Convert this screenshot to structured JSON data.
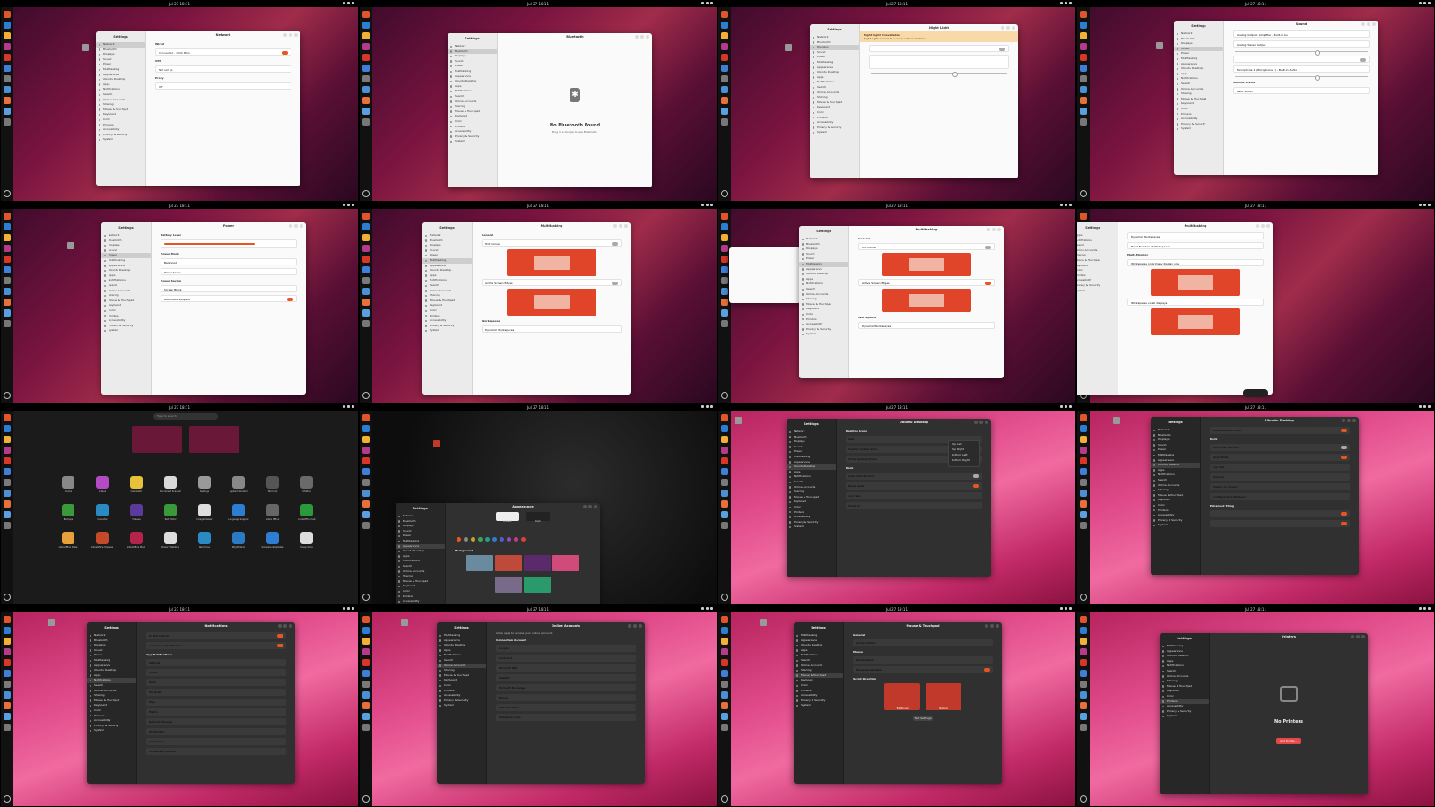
{
  "clock": "Jul 27  18:11",
  "dock_colors": [
    "#e2552b",
    "#2d7dd2",
    "#f2b134",
    "#b63a8a",
    "#d9362a",
    "#3e7fd9",
    "#7a7a7a",
    "#4b8fd4",
    "#e8703a",
    "#5aa0e0",
    "#777777"
  ],
  "settings_sidebar": [
    "Network",
    "Bluetooth",
    "Displays",
    "Sound",
    "Power",
    "Multitasking",
    "Appearance",
    "Ubuntu Desktop",
    "Apps",
    "Notifications",
    "Search",
    "Online Accounts",
    "Sharing",
    "Mouse & Touchpad",
    "Keyboard",
    "Color",
    "Printers",
    "Accessibility",
    "Privacy & Security",
    "System"
  ],
  "settings_label": "Settings",
  "panels": {
    "network": {
      "title": "Network",
      "wired": "Wired",
      "wired_value": "Connected - 1000 Mb/s",
      "vpn": "VPN",
      "vpn_value": "Not set up",
      "proxy": "Proxy",
      "proxy_value": "Off"
    },
    "bluetooth": {
      "title": "Bluetooth",
      "heading": "No Bluetooth Found",
      "sub": "Plug in a dongle to use Bluetooth."
    },
    "displays": {
      "title": "Night Light",
      "banner_title": "Night Light Unavailable",
      "banner_sub": "Night Light cannot be used in virtual machines"
    },
    "sound": {
      "title": "Sound",
      "output_device": "Analog Output - Amplifier - Built-in Au",
      "test": "Test…",
      "configuration": "Analog Stereo Output",
      "input_device": "Microphone 1 (Microphone 1) - Built-in Audio",
      "volume_levels": "Volume Levels",
      "alert_sound": "Alert Sound",
      "alert_value": "Click"
    },
    "power": {
      "title": "Power",
      "battery": "Battery Level",
      "battery_value": "67%",
      "power_mode": "Power Mode",
      "balanced": "Balanced",
      "power_saver": "Power Saver",
      "power_saving": "Power Saving",
      "screen_blank": "Screen Blank",
      "screen_blank_value": "5 minutes",
      "auto_suspend": "Automatic Suspend"
    },
    "multitasking": {
      "title": "Multitasking",
      "general": "General",
      "hot_corner": "Hot Corner",
      "active_edges": "Active Screen Edges",
      "workspaces": "Workspaces",
      "dynamic_ws": "Dynamic Workspaces",
      "fixed_ws": "Fixed Number of Workspaces",
      "multi_monitor": "Multi-Monitor",
      "primary_only": "Workspaces on primary display only",
      "all_displays": "Workspaces on all displays"
    },
    "appearance": {
      "title": "Appearance",
      "style": "Style",
      "default": "Default",
      "dark": "Dark",
      "color": "Color",
      "background": "Background",
      "add_picture": "+ Add Picture…",
      "accents": [
        "#e95420",
        "#8a8a8a",
        "#c7a32e",
        "#3ba55a",
        "#2a9c8c",
        "#2d7dd2",
        "#4a5fd6",
        "#9b4ac4",
        "#c63c84",
        "#e23d3d"
      ]
    },
    "ubuntu_desktop": {
      "title": "Ubuntu Desktop",
      "desktop_icons": "Desktop Icons",
      "size": "Size",
      "size_value": "Small",
      "position": "Position of New Icons",
      "position_value": "Bottom Right",
      "show_home": "Show Personal Folder",
      "dock": "Dock",
      "autohide": "Auto-hide the Dock",
      "panel_mode": "Panel Mode",
      "icon_size": "Icon Size",
      "show_on": "Show On",
      "show_on_value": "Primary Display (1)",
      "position_screen": "Position on Screen",
      "position_screen_value": "Left",
      "configure": "Configure Dock Behavior",
      "enhanced_tiling": "Enhanced Tiling",
      "popup": [
        "Top Left",
        "Top Right",
        "Bottom Left",
        "Bottom Right"
      ]
    },
    "notifications": {
      "title": "Notifications",
      "dnd": "Do Not Disturb",
      "lock_screen": "Lock Screen Notifications",
      "app_notifications": "App Notifications",
      "apps": [
        "Settings",
        "Clocks",
        "Disks",
        "File Roller",
        "Files",
        "Firefox",
        "Network Manager",
        "Rhythmbox",
        "Snap Store",
        "Software & Updates"
      ]
    },
    "online_accounts": {
      "title": "Online Accounts",
      "subtitle": "Allow apps to access your online accounts",
      "connect": "Connect an Account",
      "providers": [
        "Google",
        "Nextcloud",
        "Microsoft 365",
        "WebDAV",
        "Microsoft Exchange",
        "Fedora",
        "IMAP and SMTP",
        "Enterprise Login"
      ]
    },
    "mouse": {
      "title": "Mouse & Touchpad",
      "general": "General",
      "primary_button": "Primary Button",
      "left": "Left",
      "right": "Right",
      "mouse": "Mouse",
      "pointer_speed": "Pointer Speed",
      "accel": "Mouse Acceleration",
      "scroll_direction": "Scroll Direction",
      "traditional": "Traditional",
      "natural": "Natural",
      "test": "Test Settings"
    },
    "printers": {
      "title": "Printers",
      "heading": "No Printers",
      "add": "Add Printer…"
    },
    "app_grid": {
      "search": "Type to search",
      "apps": [
        "Clocks",
        "Videos",
        "Calculator",
        "Document Scanner",
        "Settings",
        "System Monitor",
        "Terminal",
        "Utilities",
        "Backups",
        "Calendar",
        "Cheese",
        "Text Editor",
        "Image Viewer",
        "Language Support",
        "Libre Office",
        "LibreOffice Calc",
        "LibreOffice Draw",
        "LibreOffice Impress",
        "LibreOffice Math",
        "Power Statistics",
        "Remmina",
        "Rhythmbox",
        "Software & Updates",
        "Snap Store"
      ]
    },
    "corner_label": "Gallery"
  }
}
